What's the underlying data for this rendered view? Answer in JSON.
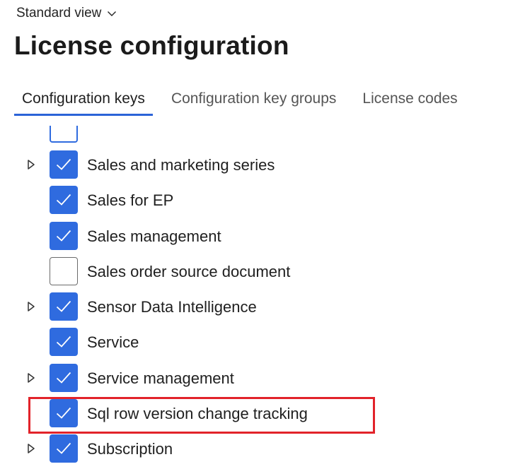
{
  "view": {
    "label": "Standard view",
    "icon": "chevron-down-icon"
  },
  "page": {
    "title": "License configuration"
  },
  "tabs": [
    {
      "label": "Configuration keys",
      "active": true
    },
    {
      "label": "Configuration key groups",
      "active": false
    },
    {
      "label": "License codes",
      "active": false
    }
  ],
  "tree": {
    "items": [
      {
        "label": "Sales and marketing series",
        "checked": true,
        "expandable": true
      },
      {
        "label": "Sales for EP",
        "checked": true,
        "expandable": false
      },
      {
        "label": "Sales management",
        "checked": true,
        "expandable": false
      },
      {
        "label": "Sales order source document",
        "checked": false,
        "expandable": false
      },
      {
        "label": "Sensor Data Intelligence",
        "checked": true,
        "expandable": true
      },
      {
        "label": "Service",
        "checked": true,
        "expandable": false
      },
      {
        "label": "Service management",
        "checked": true,
        "expandable": true
      },
      {
        "label": "Sql row version change tracking",
        "checked": true,
        "expandable": false,
        "highlighted": true
      },
      {
        "label": "Subscription",
        "checked": true,
        "expandable": true
      }
    ]
  },
  "colors": {
    "accent": "#2f6bdf",
    "highlight": "#e2232a",
    "tab_underline": "#2b63d8"
  }
}
